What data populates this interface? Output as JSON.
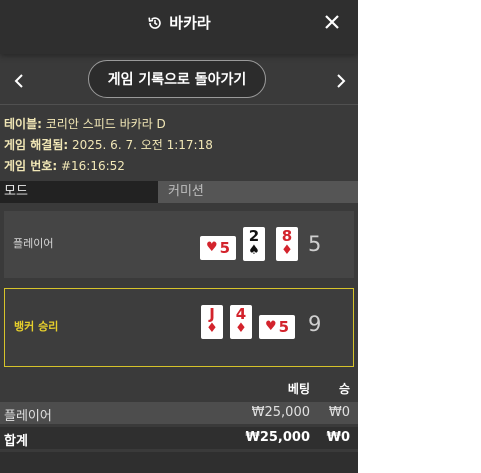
{
  "header": {
    "title": "바카라",
    "history_icon": "history-icon",
    "close_icon": "close-icon"
  },
  "nav": {
    "prev_icon": "chevron-left-icon",
    "next_icon": "chevron-right-icon",
    "back_button": "게임 기록으로 돌아가기"
  },
  "info": {
    "table_label": "테이블:",
    "table_value": "코리안 스피드 바카라 D",
    "settled_label": "게임 해결됨:",
    "settled_value": "2025. 6. 7. 오전 1:17:18",
    "game_no_label": "게임 번호:",
    "game_no_value": "#16:16:52"
  },
  "mode": {
    "label": "모드",
    "value": "커미션"
  },
  "player": {
    "label": "플레이어",
    "score": "5",
    "cards": [
      {
        "rank": "5",
        "suit": "♥",
        "color": "#d3232c",
        "orientation": "horizontal"
      },
      {
        "rank": "2",
        "suit": "♠",
        "color": "#111111",
        "orientation": "vertical"
      },
      {
        "rank": "8",
        "suit": "♦",
        "color": "#d3232c",
        "orientation": "vertical"
      }
    ]
  },
  "banker": {
    "label": "뱅커 승리",
    "label_color": "#e6cf2c",
    "score": "9",
    "cards": [
      {
        "rank": "J",
        "suit": "♦",
        "color": "#d3232c",
        "orientation": "vertical"
      },
      {
        "rank": "4",
        "suit": "♦",
        "color": "#d3232c",
        "orientation": "vertical"
      },
      {
        "rank": "5",
        "suit": "♥",
        "color": "#d3232c",
        "orientation": "horizontal"
      }
    ]
  },
  "bets": {
    "header_bet": "베팅",
    "header_win": "승",
    "rows": [
      {
        "name": "플레이어",
        "amount": "₩25,000",
        "win": "₩0"
      }
    ],
    "total": {
      "name": "합계",
      "amount": "₩25,000",
      "win": "₩0"
    }
  },
  "colors": {
    "accent_border": "#d6c32a",
    "panel_bg": "#3a3a3a"
  }
}
